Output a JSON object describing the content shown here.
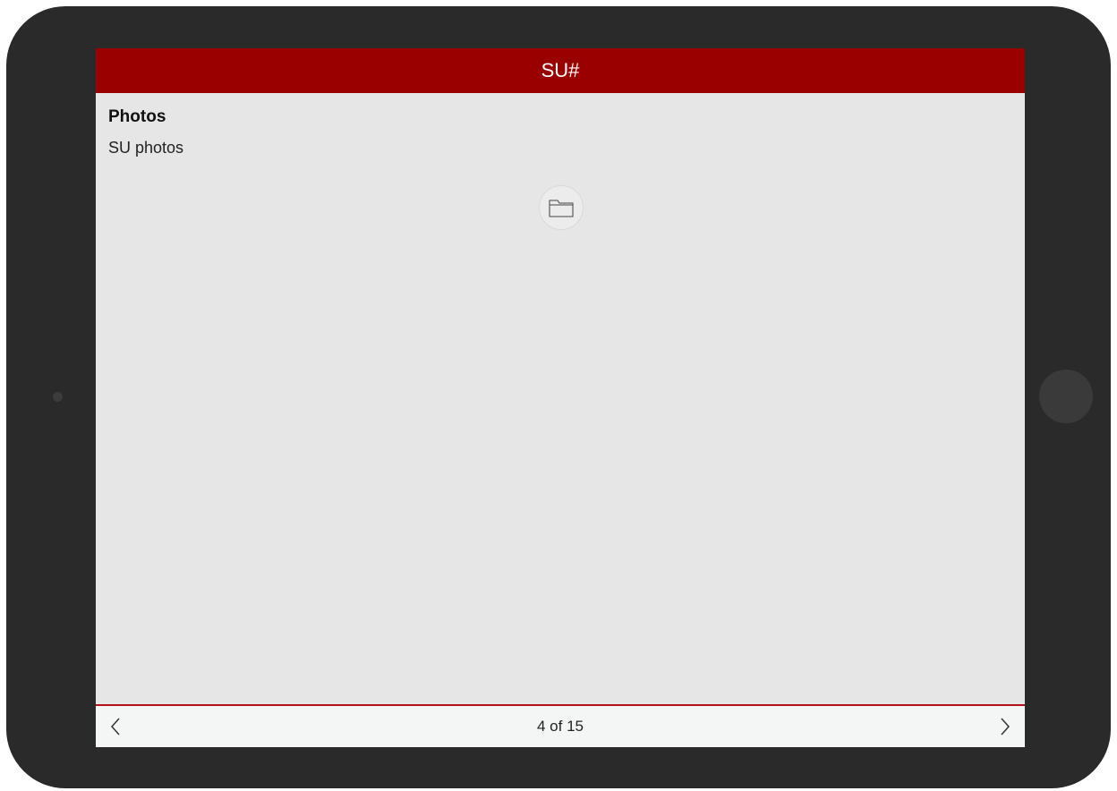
{
  "header": {
    "title": "SU#"
  },
  "section": {
    "title": "Photos",
    "description": "SU photos"
  },
  "attachment": {
    "icon": "folder-icon"
  },
  "footer": {
    "page_indicator": "4 of 15",
    "prev_icon": "chevron-left-icon",
    "next_icon": "chevron-right-icon"
  },
  "colors": {
    "header_background": "#990000",
    "footer_border": "#b3121a",
    "screen_background": "#e6e6e6",
    "device_frame": "#2a2a2a"
  }
}
